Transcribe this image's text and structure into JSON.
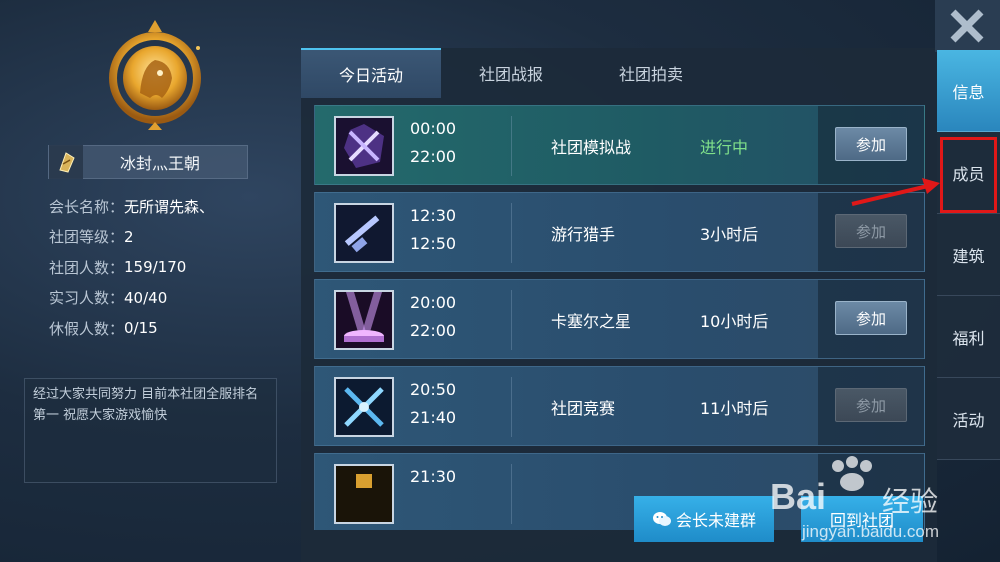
{
  "guild": {
    "name": "冰封灬王朝",
    "stats": [
      {
        "label": "会长名称：",
        "value": "无所谓先森、"
      },
      {
        "label": "社团等级：",
        "value": "2"
      },
      {
        "label": "社团人数：",
        "value": "159/170"
      },
      {
        "label": "实习人数：",
        "value": "40/40"
      },
      {
        "label": "休假人数：",
        "value": "0/15"
      }
    ],
    "notice": "经过大家共同努力 目前本社团全服排名第一 祝愿大家游戏愉快"
  },
  "tabs": [
    "今日活动",
    "社团战报",
    "社团拍卖"
  ],
  "activities": [
    {
      "start": "00:00",
      "end": "22:00",
      "name": "社团模拟战",
      "status": "进行中",
      "button": "参加",
      "button_enabled": true,
      "live": true,
      "icon": "crossed-swords-purple-icon"
    },
    {
      "start": "12:30",
      "end": "12:50",
      "name": "游行猎手",
      "status": "3小时后",
      "button": "参加",
      "button_enabled": false,
      "live": false,
      "icon": "shotgun-icon"
    },
    {
      "start": "20:00",
      "end": "22:00",
      "name": "卡塞尔之星",
      "status": "10小时后",
      "button": "参加",
      "button_enabled": true,
      "live": false,
      "icon": "stage-spotlight-icon"
    },
    {
      "start": "20:50",
      "end": "21:40",
      "name": "社团竞赛",
      "status": "11小时后",
      "button": "参加",
      "button_enabled": false,
      "live": false,
      "icon": "crossed-swords-blue-icon"
    },
    {
      "start": "21:30",
      "end": "",
      "name": "",
      "status": "",
      "button": "",
      "button_enabled": false,
      "live": false,
      "icon": "trophy-icon"
    }
  ],
  "bottom_buttons": {
    "group": "会长未建群",
    "back": "回到社团"
  },
  "side_nav": [
    "信息",
    "成员",
    "建筑",
    "福利",
    "活动"
  ],
  "watermark": {
    "brand": "Bai",
    "brand_suffix": "经验",
    "url": "jingyan.baidu.com"
  },
  "colors": {
    "accent": "#4fc3ef",
    "live_status": "#7fe08a",
    "annotation_red": "#e01818"
  }
}
